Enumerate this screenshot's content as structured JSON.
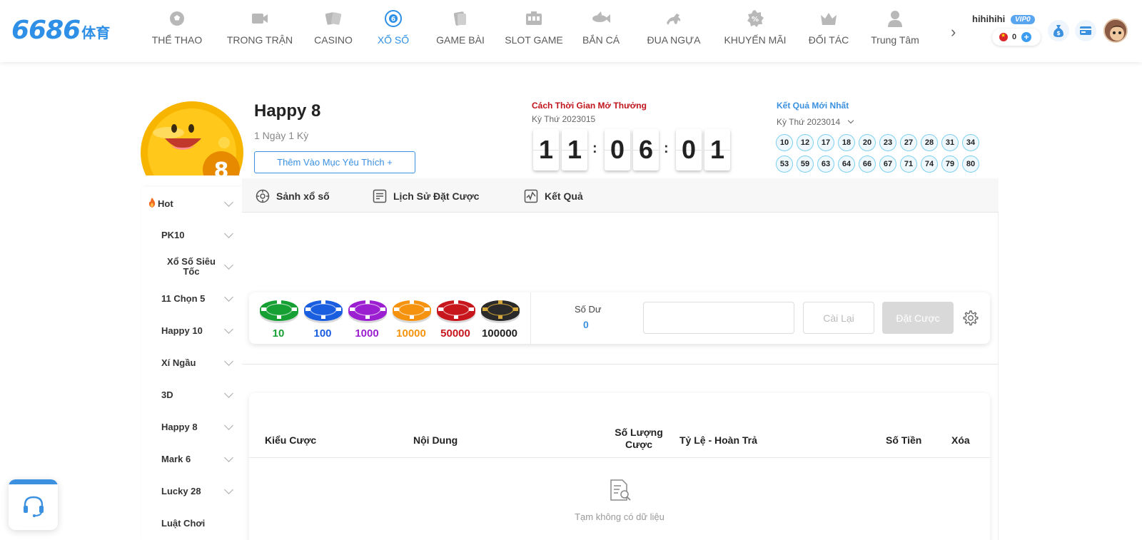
{
  "logo": {
    "number": "6686",
    "suffix": "体育"
  },
  "nav": [
    {
      "label": "THỂ THAO",
      "icon": "soccer-ball-icon",
      "active": false
    },
    {
      "label": "TRONG TRẬN",
      "icon": "video-camera-icon",
      "active": false
    },
    {
      "label": "CASINO",
      "icon": "playing-cards-icon",
      "active": false
    },
    {
      "label": "XỔ SỐ",
      "icon": "lottery-ball-icon",
      "active": true
    },
    {
      "label": "GAME BÀI",
      "icon": "card-game-icon",
      "active": false
    },
    {
      "label": "SLOT GAME",
      "icon": "slot-machine-icon",
      "active": false
    },
    {
      "label": "BẮN CÁ",
      "icon": "fish-icon",
      "active": false
    },
    {
      "label": "ĐUA NGỰA",
      "icon": "horse-icon",
      "active": false
    },
    {
      "label": "KHUYẾN MÃI",
      "icon": "percent-badge-icon",
      "active": false
    },
    {
      "label": "ĐỐI TÁC",
      "icon": "crown-icon",
      "active": false
    },
    {
      "label": "Trung Tâm",
      "icon": "user-icon",
      "active": false
    }
  ],
  "user": {
    "name": "hihihihi",
    "vip": "VIP0",
    "balance": "0"
  },
  "game": {
    "title": "Happy 8",
    "subtitle": "1 Ngày 1 Kỳ",
    "favorite_label": "Thêm Vào Mục Yêu Thích +",
    "logo_number": "8"
  },
  "countdown": {
    "title": "Cách Thời Gian Mở Thưởng",
    "period": "Kỳ Thứ 2023015",
    "digits": [
      "1",
      "1",
      "0",
      "6",
      "0",
      "1"
    ],
    "separator": ":"
  },
  "latest_result": {
    "title": "Kết Quả Mới Nhất",
    "period": "Kỳ Thứ 2023014",
    "numbers": [
      "10",
      "12",
      "17",
      "18",
      "20",
      "23",
      "27",
      "28",
      "31",
      "34",
      "53",
      "59",
      "63",
      "64",
      "66",
      "67",
      "71",
      "74",
      "79",
      "80"
    ]
  },
  "sidebar": [
    {
      "label": "Hot",
      "hot": true
    },
    {
      "label": "PK10"
    },
    {
      "label": "Xổ Số Siêu Tốc"
    },
    {
      "label": "11 Chọn 5"
    },
    {
      "label": "Happy 10"
    },
    {
      "label": "Xí Ngầu"
    },
    {
      "label": "3D"
    },
    {
      "label": "Happy 8"
    },
    {
      "label": "Mark 6"
    },
    {
      "label": "Lucky 28"
    },
    {
      "label": "Luật Chơi"
    }
  ],
  "tabs": [
    {
      "label": "Sảnh xổ số",
      "icon": "lottery-hall-icon"
    },
    {
      "label": "Lịch Sử Đặt Cược",
      "icon": "history-list-icon"
    },
    {
      "label": "Kết Quả",
      "icon": "result-chart-icon"
    }
  ],
  "chips": [
    {
      "value": "10",
      "color": "#16a034",
      "label_color": "#16a034"
    },
    {
      "value": "100",
      "color": "#1a5ee0",
      "label_color": "#1a5ee0"
    },
    {
      "value": "1000",
      "color": "#9b1fd0",
      "label_color": "#9b1fd0"
    },
    {
      "value": "10000",
      "color": "#f5930f",
      "label_color": "#f5930f"
    },
    {
      "value": "50000",
      "color": "#c8161d",
      "label_color": "#c8161d"
    },
    {
      "value": "100000",
      "color": "#2a2a2a",
      "label_color": "#222222"
    }
  ],
  "bet_panel": {
    "balance_label": "Số Dư",
    "balance_value": "0",
    "amount_value": "",
    "reset_label": "Cài Lại",
    "place_label": "Đặt Cược"
  },
  "bet_table": {
    "headers": [
      "Kiểu Cược",
      "Nội Dung",
      "Số Lượng Cược",
      "Tỷ Lệ - Hoàn Trả",
      "Số Tiền",
      "Xóa"
    ],
    "empty_text": "Tạm không có dữ liệu"
  },
  "colors": {
    "brand": "#2e8fe6",
    "countdown_title": "#c0141b",
    "result_title": "#3b90e0"
  }
}
